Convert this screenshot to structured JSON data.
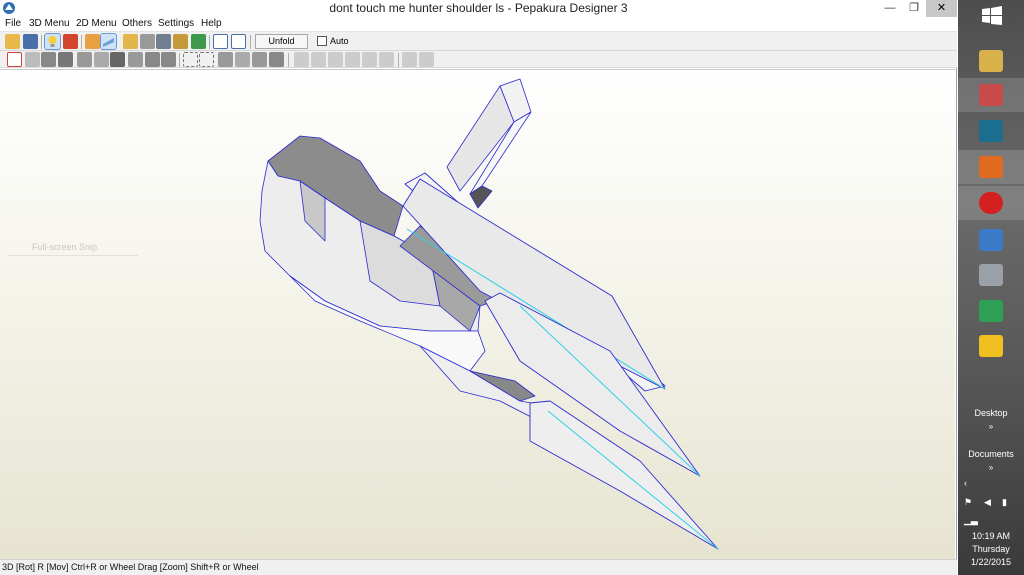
{
  "window": {
    "title": "dont touch me hunter shoulder ls - Pepakura Designer 3",
    "min_glyph": "—",
    "max_glyph": "❐",
    "close_glyph": "✕"
  },
  "menu": [
    "File",
    "3D Menu",
    "2D Menu",
    "Others",
    "Settings",
    "Help"
  ],
  "toolbar": {
    "unfold_label": "Unfold",
    "auto_label": "Auto",
    "auto_checked": false
  },
  "viewport": {
    "snip_label": "Full-screen Snip"
  },
  "status": {
    "text": "3D [Rot] R [Mov] Ctrl+R or Wheel Drag [Zoom] Shift+R or Wheel"
  },
  "taskbar": {
    "desktop_label": "Desktop",
    "documents_label": "Documents",
    "chevron": "»",
    "time": "10:19 AM",
    "day": "Thursday",
    "date": "1/22/2015"
  },
  "colors": {
    "edge": "#2a2ad0",
    "fold": "#30d0e8",
    "face": "#e8e8e8",
    "dark_face": "#8c8c8c",
    "taskbar_icons": [
      "#d9b14a",
      "#c94a4a",
      "#1a6f8f",
      "#e06a20",
      "#d42020",
      "#3b7ac6",
      "#9aa0a8",
      "#2ea055",
      "#f0c020"
    ]
  }
}
